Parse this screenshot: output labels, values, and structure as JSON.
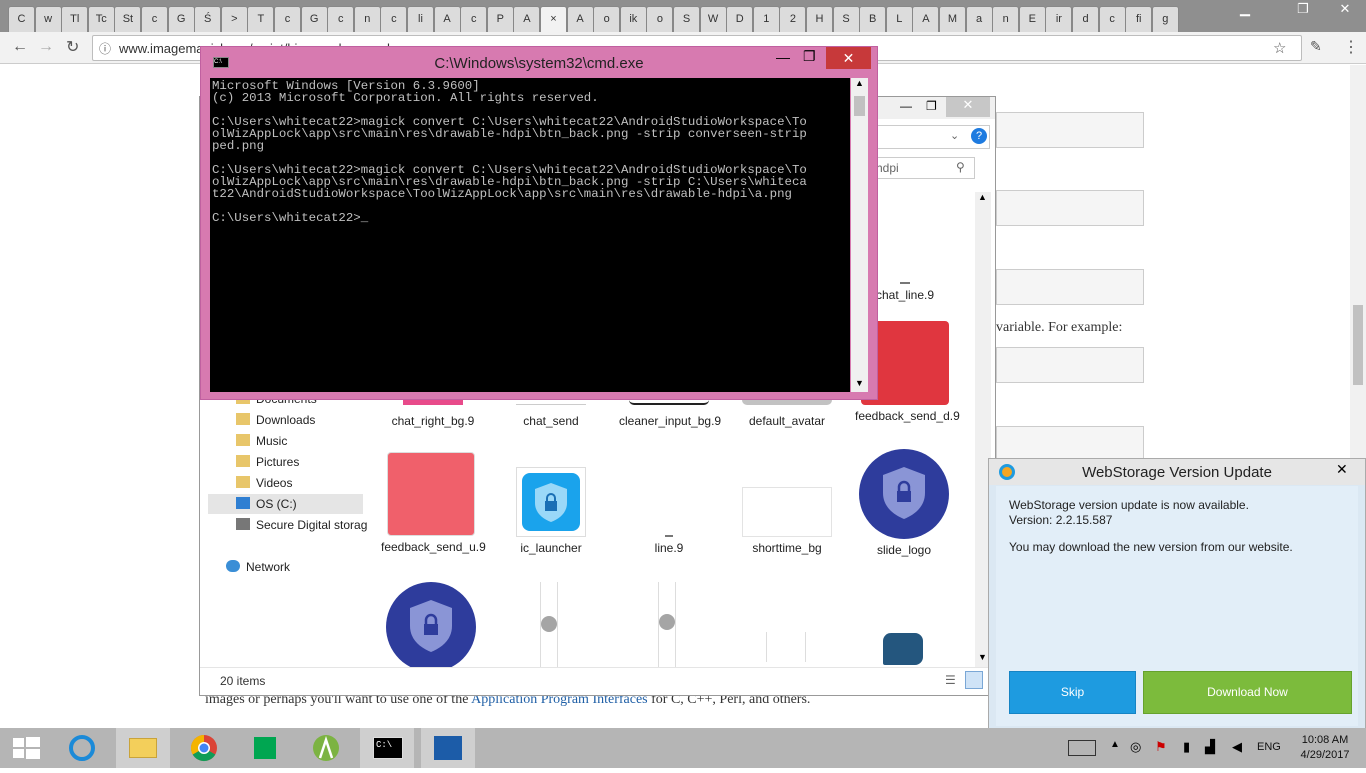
{
  "browser": {
    "tabs": [
      "C",
      "w",
      "Tl",
      "Tc",
      "St",
      "c",
      "G",
      "Ś",
      ">",
      "T",
      "c",
      "G",
      "c",
      "n",
      "c",
      "li",
      "A",
      "c",
      "P",
      "A",
      "",
      "A",
      "o",
      "ik",
      "o",
      "S",
      "W",
      "D",
      "1",
      "2",
      "H",
      "S",
      "B",
      "L",
      "A",
      "M",
      "a",
      "n",
      "E",
      "ir",
      "d",
      "c",
      "fi",
      "g"
    ],
    "url": "www.imagemagick.org/script/binary-releases.php",
    "close_glyph": "×"
  },
  "webpage": {
    "text_example": "variable. For example:",
    "text_bottom_pre": "images or perhaps you'll want to use one of the ",
    "text_bottom_link": "Application Program Interfaces",
    "text_bottom_post": " for C, C++, Perl, and others."
  },
  "explorer": {
    "search_placeholder": "hdpi",
    "nav_items": [
      "Documents",
      "Downloads",
      "Music",
      "Pictures",
      "Videos",
      "OS (C:)",
      "Secure Digital storag",
      "Network"
    ],
    "status": "20 items",
    "files": [
      {
        "name": "chat_line.9"
      },
      {
        "name": "feedback_send_d.9"
      },
      {
        "name": "chat_right_bg.9"
      },
      {
        "name": "chat_send"
      },
      {
        "name": "cleaner_input_bg.9"
      },
      {
        "name": "default_avatar"
      },
      {
        "name": "feedback_send_u.9"
      },
      {
        "name": "ic_launcher"
      },
      {
        "name": "line.9"
      },
      {
        "name": "shorttime_bg"
      },
      {
        "name": "slide_logo"
      }
    ]
  },
  "cmd": {
    "title": "C:\\Windows\\system32\\cmd.exe",
    "console_text": "Microsoft Windows [Version 6.3.9600]\n(c) 2013 Microsoft Corporation. All rights reserved.\n\nC:\\Users\\whitecat22>magick convert C:\\Users\\whitecat22\\AndroidStudioWorkspace\\To\nolWizAppLock\\app\\src\\main\\res\\drawable-hdpi\\btn_back.png -strip converseen-strip\nped.png\n\nC:\\Users\\whitecat22>magick convert C:\\Users\\whitecat22\\AndroidStudioWorkspace\\To\nolWizAppLock\\app\\src\\main\\res\\drawable-hdpi\\btn_back.png -strip C:\\Users\\whiteca\nt22\\AndroidStudioWorkspace\\ToolWizAppLock\\app\\src\\main\\res\\drawable-hdpi\\a.png\n\nC:\\Users\\whitecat22>_"
  },
  "webstorage": {
    "title": "WebStorage Version Update",
    "line1": "WebStorage version update is now available.",
    "line2": "Version: 2.2.15.587",
    "line3": "You may download the new version from our website.",
    "skip_label": "Skip",
    "download_label": "Download Now"
  },
  "taskbar": {
    "language": "ENG",
    "time": "10:08 AM",
    "date": "4/29/2017"
  },
  "colors": {
    "cmd_frame": "#d77ab0",
    "ws_skip": "#1e9be0",
    "ws_download": "#7cbb3c",
    "shield_dark": "#2e3c9c"
  }
}
